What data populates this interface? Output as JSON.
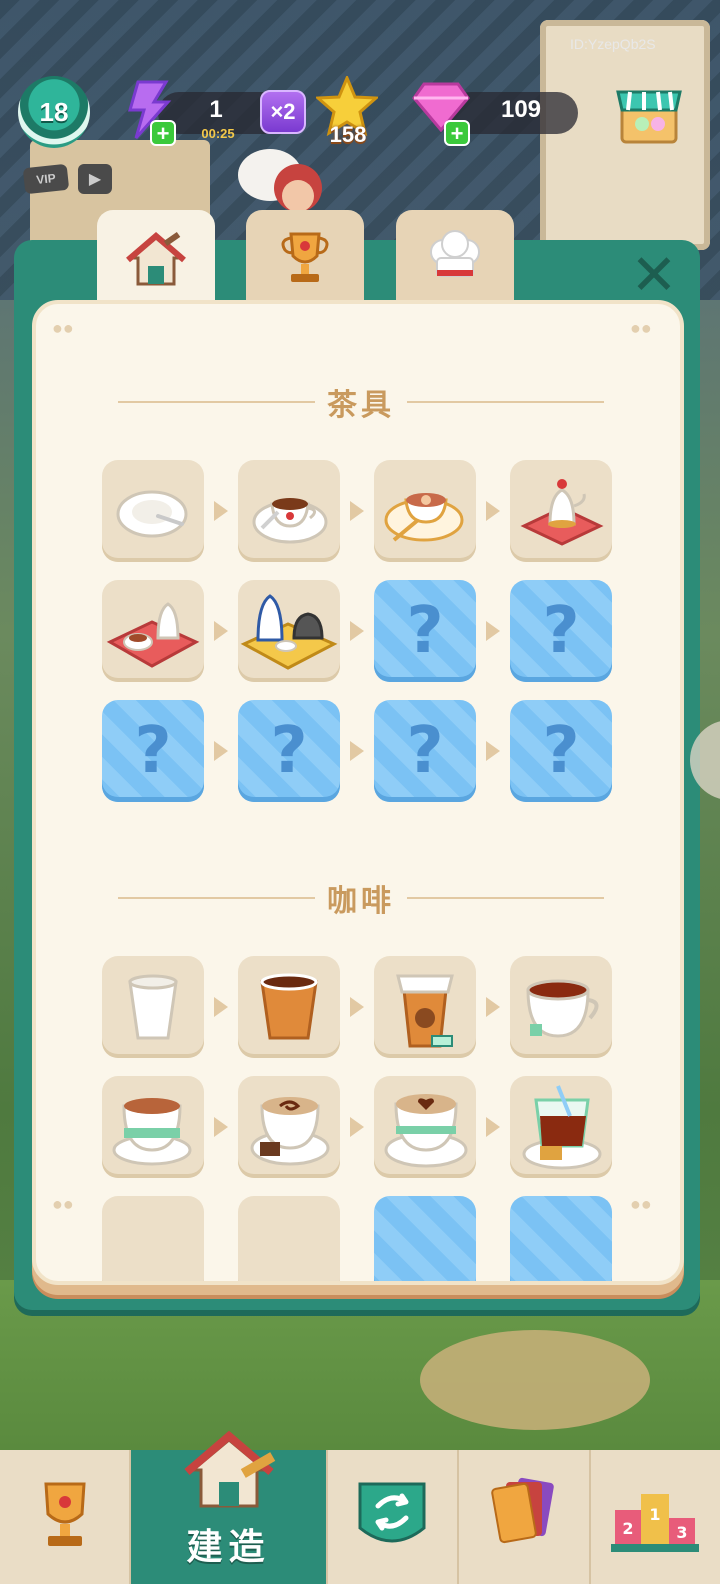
{
  "hud": {
    "level": "18",
    "vip_label": "VIP",
    "energy_count": "1",
    "energy_timer": "00:25",
    "boost_label": "×2",
    "star_count": "158",
    "gem_count": "109",
    "player_id": "ID:YzepQb2S"
  },
  "tabs": [
    {
      "name": "build",
      "icon": "house-icon",
      "active": true
    },
    {
      "name": "trophy",
      "icon": "trophy-icon",
      "active": false
    },
    {
      "name": "chef",
      "icon": "chef-hat-icon",
      "active": false
    }
  ],
  "sections": [
    {
      "title": "茶具",
      "items": [
        {
          "icon": "plate-icon",
          "state": "unlocked"
        },
        {
          "icon": "teacup-icon",
          "state": "unlocked"
        },
        {
          "icon": "gold-teacup-icon",
          "state": "unlocked"
        },
        {
          "icon": "teapot-icon",
          "state": "unlocked"
        },
        {
          "icon": "tea-tray-icon",
          "state": "unlocked"
        },
        {
          "icon": "tea-set-icon",
          "state": "unlocked"
        },
        {
          "icon": "question-icon",
          "state": "locked",
          "label": "?"
        },
        {
          "icon": "question-icon",
          "state": "locked",
          "label": "?"
        },
        {
          "icon": "question-icon",
          "state": "locked",
          "label": "?"
        },
        {
          "icon": "question-icon",
          "state": "locked",
          "label": "?"
        },
        {
          "icon": "question-icon",
          "state": "locked",
          "label": "?"
        },
        {
          "icon": "question-icon",
          "state": "locked",
          "label": "?"
        }
      ]
    },
    {
      "title": "咖啡",
      "items": [
        {
          "icon": "paper-cup-icon",
          "state": "unlocked"
        },
        {
          "icon": "coffee-cup-icon",
          "state": "unlocked"
        },
        {
          "icon": "takeaway-coffee-icon",
          "state": "unlocked"
        },
        {
          "icon": "tea-mug-icon",
          "state": "unlocked"
        },
        {
          "icon": "cocoa-cup-icon",
          "state": "unlocked"
        },
        {
          "icon": "swirl-latte-icon",
          "state": "unlocked"
        },
        {
          "icon": "heart-latte-icon",
          "state": "unlocked"
        },
        {
          "icon": "tea-glass-icon",
          "state": "unlocked"
        }
      ]
    }
  ],
  "bottom_nav": [
    {
      "name": "trophy",
      "icon": "trophy-icon",
      "label": ""
    },
    {
      "name": "build",
      "icon": "house-icon",
      "label": "建造",
      "active": true
    },
    {
      "name": "swap",
      "icon": "swap-arrows-icon",
      "label": ""
    },
    {
      "name": "cards",
      "icon": "cards-icon",
      "label": ""
    },
    {
      "name": "ranking",
      "icon": "podium-icon",
      "label": ""
    }
  ],
  "colors": {
    "panel_teal": "#2c8c78",
    "panel_cream": "#fbf6ea",
    "locked_blue": "#7bc2f4",
    "header_gold": "#c99a5e"
  }
}
